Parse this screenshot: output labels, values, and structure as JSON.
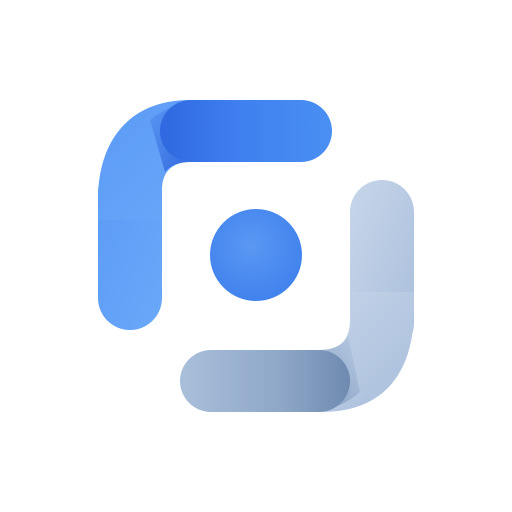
{
  "app_icon": {
    "icon_name": "app-logo-icon",
    "colors": {
      "background": "#ffffff",
      "blue_light": "#6aa6f8",
      "blue_mid": "#4a8ef0",
      "blue_dark": "#2a63dd",
      "slate_light": "#c9d7ea",
      "slate_mid": "#9fb5d3",
      "slate_dark": "#7a93b8",
      "dot": "#4c8df0"
    }
  }
}
